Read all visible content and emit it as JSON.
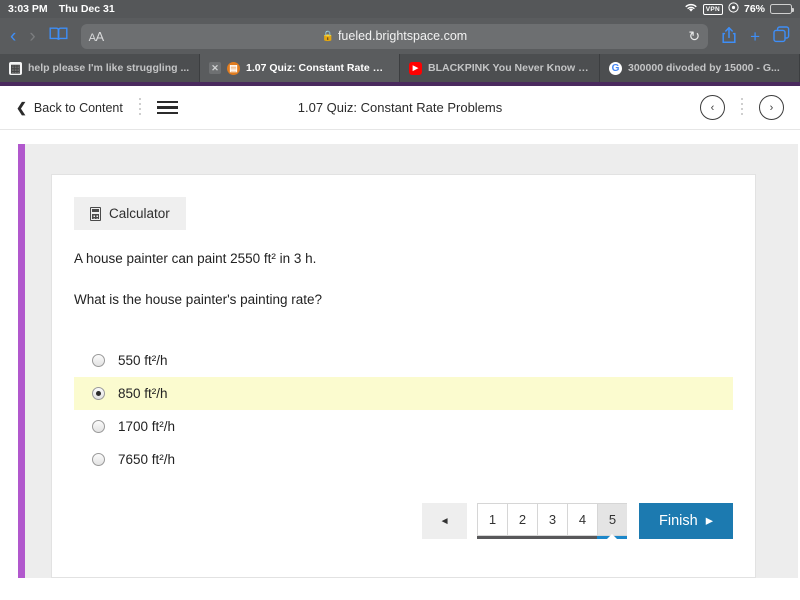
{
  "status_bar": {
    "time": "3:03 PM",
    "date": "Thu Dec 31",
    "wifi_icon": "wifi-icon",
    "vpn_label": "VPN",
    "location_icon": "location-icon",
    "battery_percent": "76%",
    "battery_icon": "battery-icon"
  },
  "browser": {
    "back_icon": "back-chevron-icon",
    "forward_icon": "forward-chevron-icon",
    "bookmarks_icon": "book-icon",
    "text_size_label": "AA",
    "lock_icon": "lock-icon",
    "url": "fueled.brightspace.com",
    "reload_icon": "reload-icon",
    "share_icon": "share-icon",
    "new_tab_icon": "plus-icon",
    "tabs_icon": "tabs-icon",
    "tabs": [
      {
        "title": "help please I'm like struggling ...",
        "favicon": "document-icon",
        "active": false,
        "closable": false
      },
      {
        "title": "1.07 Quiz: Constant Rate Probl...",
        "favicon": "brightspace-icon",
        "active": true,
        "closable": true,
        "close_label": "✕"
      },
      {
        "title": "BLACKPINK You Never Know L...",
        "favicon": "youtube-icon",
        "active": false,
        "closable": false
      },
      {
        "title": "300000 divoded by 15000 - G...",
        "favicon": "google-icon",
        "active": false,
        "closable": false
      }
    ]
  },
  "app_header": {
    "back_label": "Back to Content",
    "back_icon": "chevron-left-icon",
    "menu_icon": "hamburger-menu-icon",
    "title": "1.07 Quiz: Constant Rate Problems",
    "prev_icon": "‹",
    "next_icon": "›",
    "accent_color": "#4a2a5e"
  },
  "quiz": {
    "accent_bar_color": "#b158cd",
    "calculator_label": "Calculator",
    "calculator_icon": "calculator-icon",
    "question_line1": "A house painter can paint 2550 ft² in 3 h.",
    "question_line2": "What is the house painter's painting rate?",
    "options": [
      {
        "label": "550 ft²/h",
        "selected": false
      },
      {
        "label": "850 ft²/h",
        "selected": true
      },
      {
        "label": "1700 ft²/h",
        "selected": false
      },
      {
        "label": "7650 ft²/h",
        "selected": false
      }
    ],
    "highlight_color": "#fbfbcf"
  },
  "pager": {
    "prev_icon": "◄",
    "pages": [
      "1",
      "2",
      "3",
      "4",
      "5"
    ],
    "current_page": "5",
    "finish_label": "Finish",
    "finish_icon": "▸",
    "finish_color": "#1c7ab0"
  }
}
